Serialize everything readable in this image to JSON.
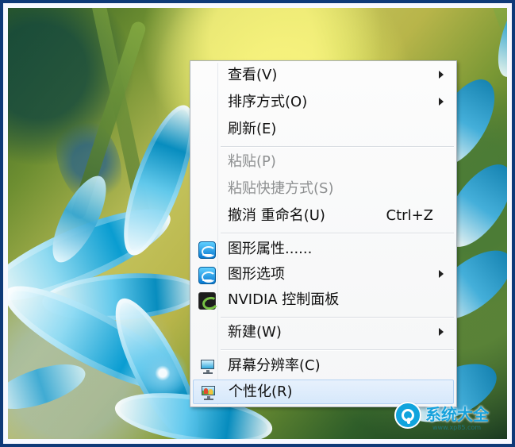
{
  "context_menu": {
    "items": [
      {
        "label": "查看(V)",
        "submenu": true,
        "state": "enabled"
      },
      {
        "label": "排序方式(O)",
        "submenu": true,
        "state": "enabled"
      },
      {
        "label": "刷新(E)",
        "submenu": false,
        "state": "enabled"
      },
      {
        "label": "粘贴(P)",
        "submenu": false,
        "state": "disabled"
      },
      {
        "label": "粘贴快捷方式(S)",
        "submenu": false,
        "state": "disabled"
      },
      {
        "label": "撤消 重命名(U)",
        "shortcut": "Ctrl+Z",
        "submenu": false,
        "state": "enabled"
      },
      {
        "label": "图形属性......",
        "icon": "intel-graphics-icon",
        "submenu": false,
        "state": "enabled"
      },
      {
        "label": "图形选项",
        "icon": "intel-graphics-icon",
        "submenu": true,
        "state": "enabled"
      },
      {
        "label": "NVIDIA 控制面板",
        "icon": "nvidia-control-panel-icon",
        "submenu": false,
        "state": "enabled"
      },
      {
        "label": "新建(W)",
        "submenu": true,
        "state": "enabled"
      },
      {
        "label": "屏幕分辨率(C)",
        "icon": "screen-resolution-icon",
        "submenu": false,
        "state": "enabled"
      },
      {
        "label": "个性化(R)",
        "icon": "personalize-icon",
        "submenu": false,
        "state": "selected"
      }
    ]
  },
  "watermark": {
    "text": "系统大全",
    "subtext": "www.xp85.com",
    "icon": "system-logo-icon"
  },
  "colors": {
    "frame_border": "#0e3a78",
    "menu_background": "#f8f9fa",
    "disabled_text": "#8e9091",
    "selected_highlight": "#dcecfc",
    "watermark_blue": "#17a2dc"
  }
}
